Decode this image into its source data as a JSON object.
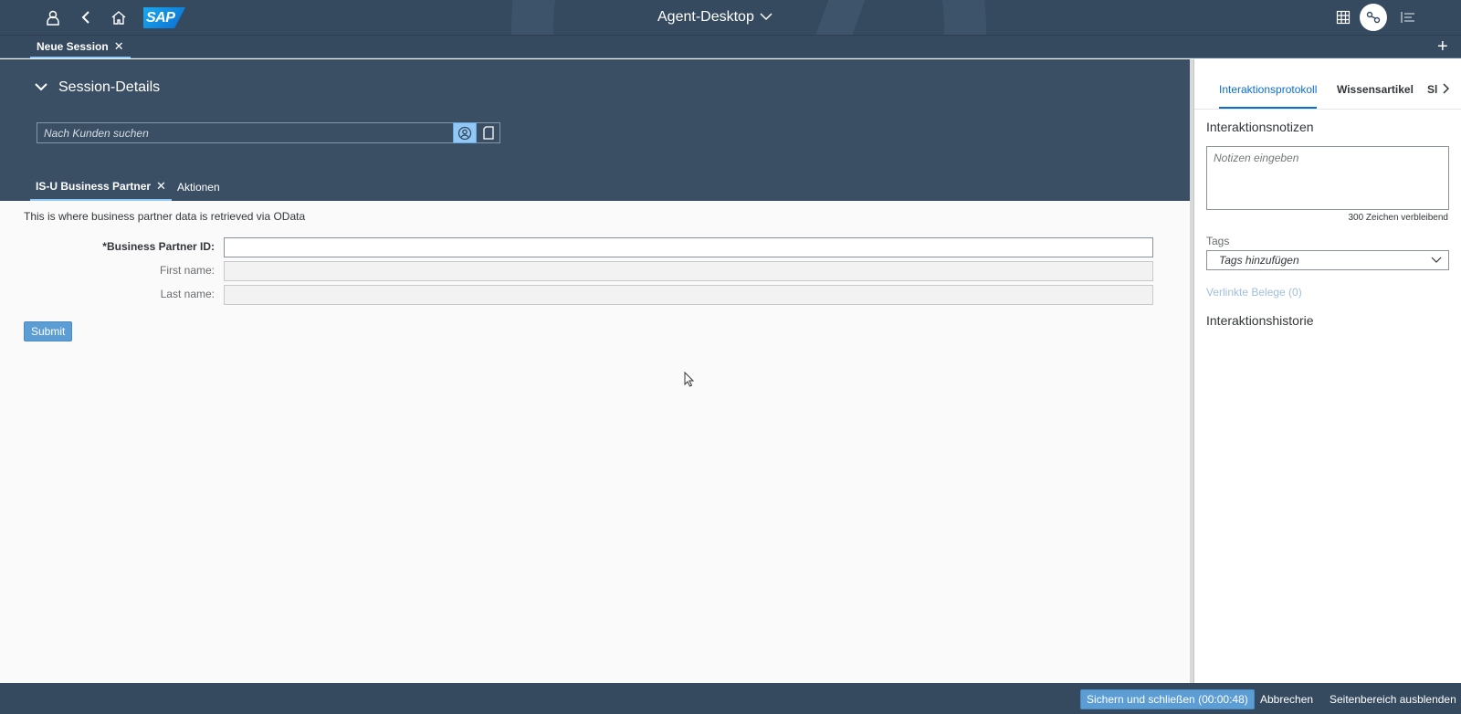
{
  "shell": {
    "title": "Agent-Desktop",
    "logo": "SAP",
    "icons": [
      "user-icon",
      "back-icon",
      "home-icon",
      "grid-icon",
      "avatar-icon",
      "notifications-icon",
      "chevron-down-icon"
    ]
  },
  "session_tabs": [
    {
      "label": "Neue Session",
      "active": true
    }
  ],
  "session_details": {
    "title": "Session-Details",
    "search_placeholder": "Nach Kunden suchen",
    "tabs": [
      {
        "label": "IS-U Business Partner",
        "active": true,
        "closable": true
      },
      {
        "label": "Aktionen",
        "active": false
      }
    ]
  },
  "main": {
    "info": "This is where business partner data is retrieved via OData",
    "fields": [
      {
        "label": "*Business Partner ID:",
        "value": "",
        "required": true,
        "readonly": false
      },
      {
        "label": "First name:",
        "value": "",
        "required": false,
        "readonly": true
      },
      {
        "label": "Last name:",
        "value": "",
        "required": false,
        "readonly": true
      }
    ],
    "submit_label": "Submit"
  },
  "side_panel": {
    "tabs": [
      "Interaktionsprotokoll",
      "Wissensartikel",
      "Sl"
    ],
    "notes_title": "Interaktionsnotizen",
    "notes_placeholder": "Notizen eingeben",
    "chars_left": "300 Zeichen verbleibend",
    "tags_label": "Tags",
    "tags_placeholder": "Tags hinzufügen",
    "linked_docs": "Verlinkte Belege (0)",
    "history_title": "Interaktionshistorie"
  },
  "footer": {
    "save_close": "Sichern und schließen (00:00:48)",
    "cancel": "Abbrechen",
    "hide_side": "Seitenbereich ausblenden"
  },
  "colors": {
    "shell": "#354a5f",
    "details_bg": "#3b4f64",
    "accent": "#0a6ed1",
    "button": "#5c9dd4"
  }
}
